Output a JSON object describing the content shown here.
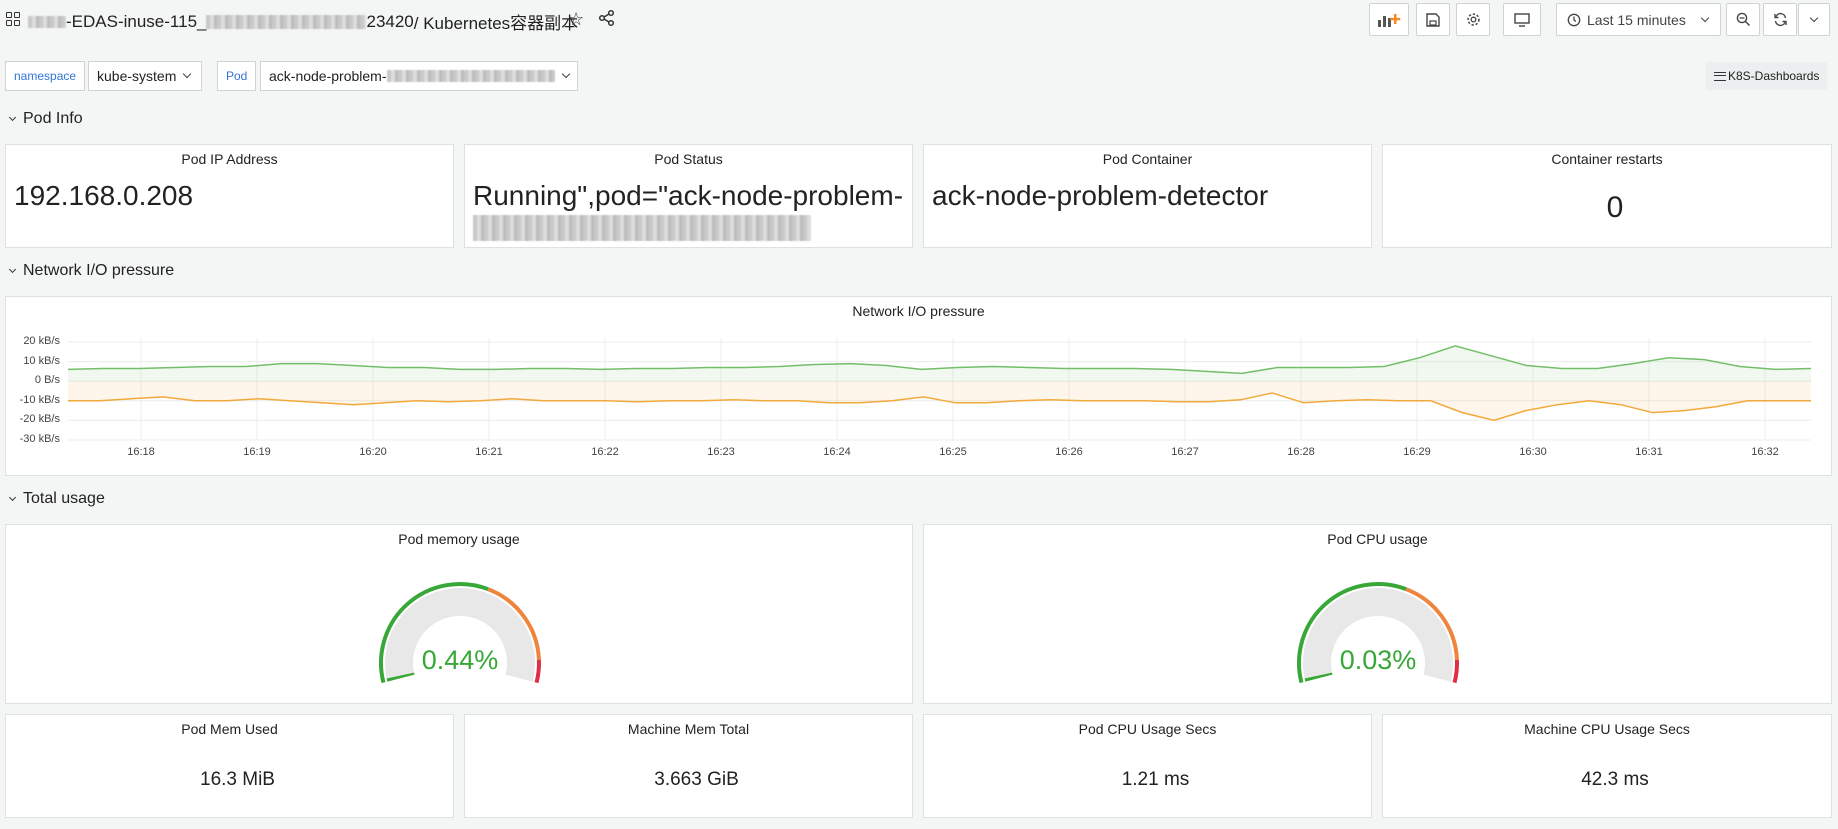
{
  "topbar": {
    "title_prefix_visible": "-EDAS-inuse-115_",
    "title_mid_visible": "23420",
    "title_suffix": " / Kubernetes容器副本",
    "time_range": "Last 15 minutes",
    "icons": [
      "apps-grid-icon",
      "star-icon",
      "share-icon",
      "add-panel-icon",
      "save-icon",
      "gear-icon",
      "tv-mode-icon",
      "clock-icon",
      "zoom-out-icon",
      "refresh-icon",
      "chevron-down-icon"
    ]
  },
  "variables": {
    "namespace_label": "namespace",
    "namespace_value": "kube-system",
    "pod_label": "Pod",
    "pod_value_visible": "ack-node-problem-",
    "dashboards_link": "K8S-Dashboards"
  },
  "rows": {
    "pod_info": "Pod Info",
    "network": "Network I/O pressure",
    "total_usage": "Total usage"
  },
  "pod_info": {
    "ip_title": "Pod IP Address",
    "ip_value": "192.168.0.208",
    "status_title": "Pod Status",
    "status_value_line1": "Running\",pod=\"ack-node-problem-",
    "container_title": "Pod Container",
    "container_value": "ack-node-problem-detector",
    "restarts_title": "Container restarts",
    "restarts_value": "0"
  },
  "network_panel": {
    "title": "Network I/O pressure",
    "y_ticks": [
      "20 kB/s",
      "10 kB/s",
      "0 B/s",
      "-10 kB/s",
      "-20 kB/s",
      "-30 kB/s"
    ],
    "x_ticks": [
      "16:18",
      "16:19",
      "16:20",
      "16:21",
      "16:22",
      "16:23",
      "16:24",
      "16:25",
      "16:26",
      "16:27",
      "16:28",
      "16:29",
      "16:30",
      "16:31",
      "16:32"
    ],
    "colors": {
      "receive": "#73bf69",
      "transmit": "#f2a93b"
    }
  },
  "chart_data": {
    "type": "area",
    "title": "Network I/O pressure",
    "ylim": [
      -30,
      20
    ],
    "y_unit": "kB/s",
    "grid": true,
    "x": [
      "16:17:40",
      "16:18:00",
      "16:18:20",
      "16:18:40",
      "16:19:00",
      "16:19:20",
      "16:19:40",
      "16:20:00",
      "16:20:20",
      "16:20:40",
      "16:21:00",
      "16:21:20",
      "16:21:40",
      "16:22:00",
      "16:22:20",
      "16:22:40",
      "16:23:00",
      "16:23:20",
      "16:23:40",
      "16:24:00",
      "16:24:20",
      "16:24:40",
      "16:25:00",
      "16:25:20",
      "16:25:40",
      "16:26:00",
      "16:26:20",
      "16:26:40",
      "16:27:00",
      "16:27:20",
      "16:27:40",
      "16:28:00",
      "16:28:20",
      "16:28:40",
      "16:29:00",
      "16:29:20",
      "16:29:40",
      "16:30:00",
      "16:30:20",
      "16:30:40",
      "16:31:00",
      "16:31:20",
      "16:31:40",
      "16:32:00",
      "16:32:20"
    ],
    "series": [
      {
        "values": [
          6,
          6.5,
          6.5,
          7,
          7.5,
          7.5,
          9,
          9,
          8,
          7,
          7,
          6,
          6,
          6.5,
          6.5,
          6,
          6.5,
          6.5,
          7,
          7,
          7.5,
          8.5,
          9,
          8,
          6,
          7,
          7.5,
          7,
          6.5,
          6.5,
          6.5,
          6,
          5,
          4,
          7,
          7,
          7,
          7.5,
          12,
          18,
          13,
          8,
          6.5,
          6.5,
          9,
          12,
          11,
          7.5,
          6,
          6.5
        ]
      },
      {
        "values": [
          -10,
          -10,
          -9,
          -8,
          -10,
          -10,
          -9,
          -10,
          -11,
          -12,
          -11,
          -10,
          -10.5,
          -10,
          -9,
          -10,
          -10,
          -10,
          -10.5,
          -10,
          -10,
          -9.5,
          -10,
          -10,
          -11,
          -11,
          -10,
          -8,
          -11,
          -11,
          -10,
          -9.5,
          -10,
          -10,
          -10,
          -10.5,
          -10.5,
          -9.5,
          -6,
          -11,
          -10,
          -9.5,
          -10,
          -10,
          -16,
          -20,
          -15,
          -12,
          -10,
          -12,
          -16,
          -15,
          -13,
          -10,
          -10,
          -10
        ]
      }
    ]
  },
  "total_usage": {
    "mem_title": "Pod memory usage",
    "mem_value": "0.44%",
    "mem_fraction": 0.0044,
    "cpu_title": "Pod CPU usage",
    "cpu_value": "0.03%",
    "cpu_fraction": 0.0003,
    "gauge_colors": {
      "green": "#37a837",
      "orange": "#ef843c",
      "red": "#e02f44",
      "track": "#e8e8e8",
      "value_text": "#37a837"
    }
  },
  "stats": {
    "mem_used_title": "Pod Mem Used",
    "mem_used_value": "16.3 MiB",
    "mem_total_title": "Machine Mem Total",
    "mem_total_value": "3.663 GiB",
    "cpu_secs_title": "Pod CPU Usage Secs",
    "cpu_secs_value": "1.21 ms",
    "machine_cpu_title": "Machine CPU Usage Secs",
    "machine_cpu_value": "42.3 ms"
  }
}
